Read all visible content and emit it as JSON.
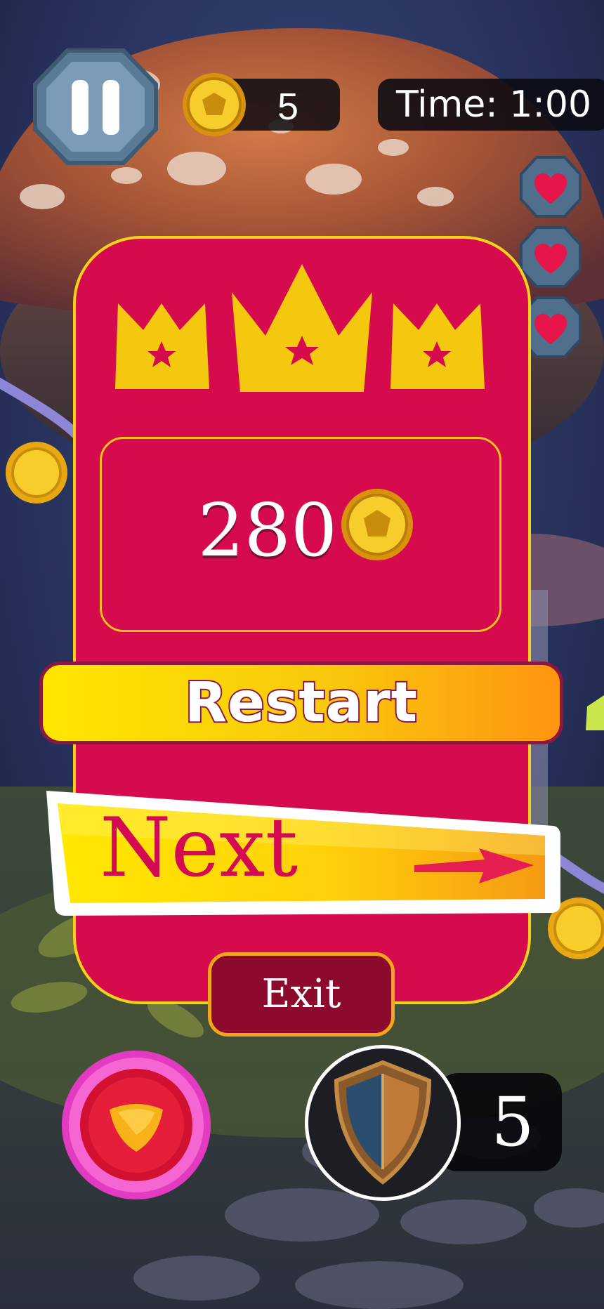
{
  "hud": {
    "coins": "5",
    "timer": "Time: 1:00",
    "lives": 3
  },
  "result": {
    "crowns": 3,
    "score": "280"
  },
  "buttons": {
    "restart": "Restart",
    "next": "Next",
    "exit": "Exit"
  },
  "bottom": {
    "shield_count": "5"
  },
  "icons": [
    "pause-icon",
    "coin-icon",
    "heart-icon",
    "crown-icon",
    "arrow-right-icon",
    "candy-icon",
    "shield-icon"
  ],
  "colors": {
    "panel": "#d50b4e",
    "panel_border": "#f6d11a",
    "crown": "#f3c80f",
    "exit": "#8c0a2c"
  }
}
